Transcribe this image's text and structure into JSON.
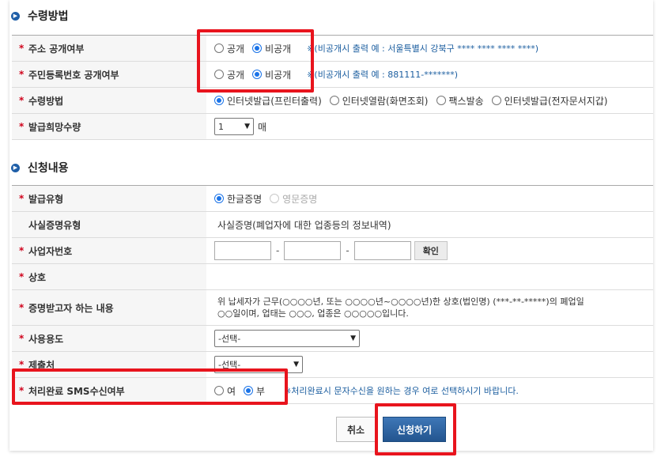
{
  "sections": {
    "receipt": {
      "title": "수령방법"
    },
    "application": {
      "title": "신청내용"
    }
  },
  "rows": {
    "address": {
      "label": "주소 공개여부",
      "options": [
        "공개",
        "비공개"
      ],
      "selected": "비공개",
      "note": "※(비공개시 출력 예 : 서울특별시 강북구 **** **** **** ****)"
    },
    "rrn": {
      "label": "주민등록번호 공개여부",
      "options": [
        "공개",
        "비공개"
      ],
      "selected": "비공개",
      "note": "※(비공개시 출력 예 : 881111-*******)"
    },
    "method": {
      "label": "수령방법",
      "options": [
        "인터넷발급(프린터출력)",
        "인터넷열람(화면조회)",
        "팩스발송",
        "인터넷발급(전자문서지갑)"
      ],
      "selected": "인터넷발급(프린터출력)"
    },
    "quantity": {
      "label": "발급희망수량",
      "value": "1",
      "unit": "매"
    },
    "type": {
      "label": "발급유형",
      "options": [
        "한글증명",
        "영문증명"
      ],
      "selected": "한글증명",
      "disabled": [
        "영문증명"
      ]
    },
    "fact_type": {
      "label": "사실증명유형",
      "value": "사실증명(폐업자에 대한 업종등의 정보내역)"
    },
    "bizno": {
      "label": "사업자번호",
      "confirm": "확인"
    },
    "trade_name": {
      "label": "상호"
    },
    "content": {
      "label": "증명받고자 하는 내용",
      "line1": "위 납세자가 근무(○○○○년, 또는 ○○○○년~○○○○년)한 상호(법인명) (***-**-*****)의 폐업일",
      "line2": "○○일이며, 업태는 ○○○, 업종은 ○○○○○입니다."
    },
    "purpose": {
      "label": "사용용도",
      "value": "-선택-"
    },
    "submit_to": {
      "label": "제출처",
      "value": "-선택-"
    },
    "sms": {
      "label": "처리완료 SMS수신여부",
      "options": [
        "여",
        "부"
      ],
      "selected": "부",
      "note": "※처리완료시 문자수신을 원하는 경우 여로 선택하시기 바랍니다."
    }
  },
  "buttons": {
    "cancel": "취소",
    "apply": "신청하기"
  },
  "colors": {
    "highlight": "#e8141d",
    "accent": "#1a73e8",
    "note": "#1d5fa0",
    "primary_button": "#2c5f9e"
  }
}
